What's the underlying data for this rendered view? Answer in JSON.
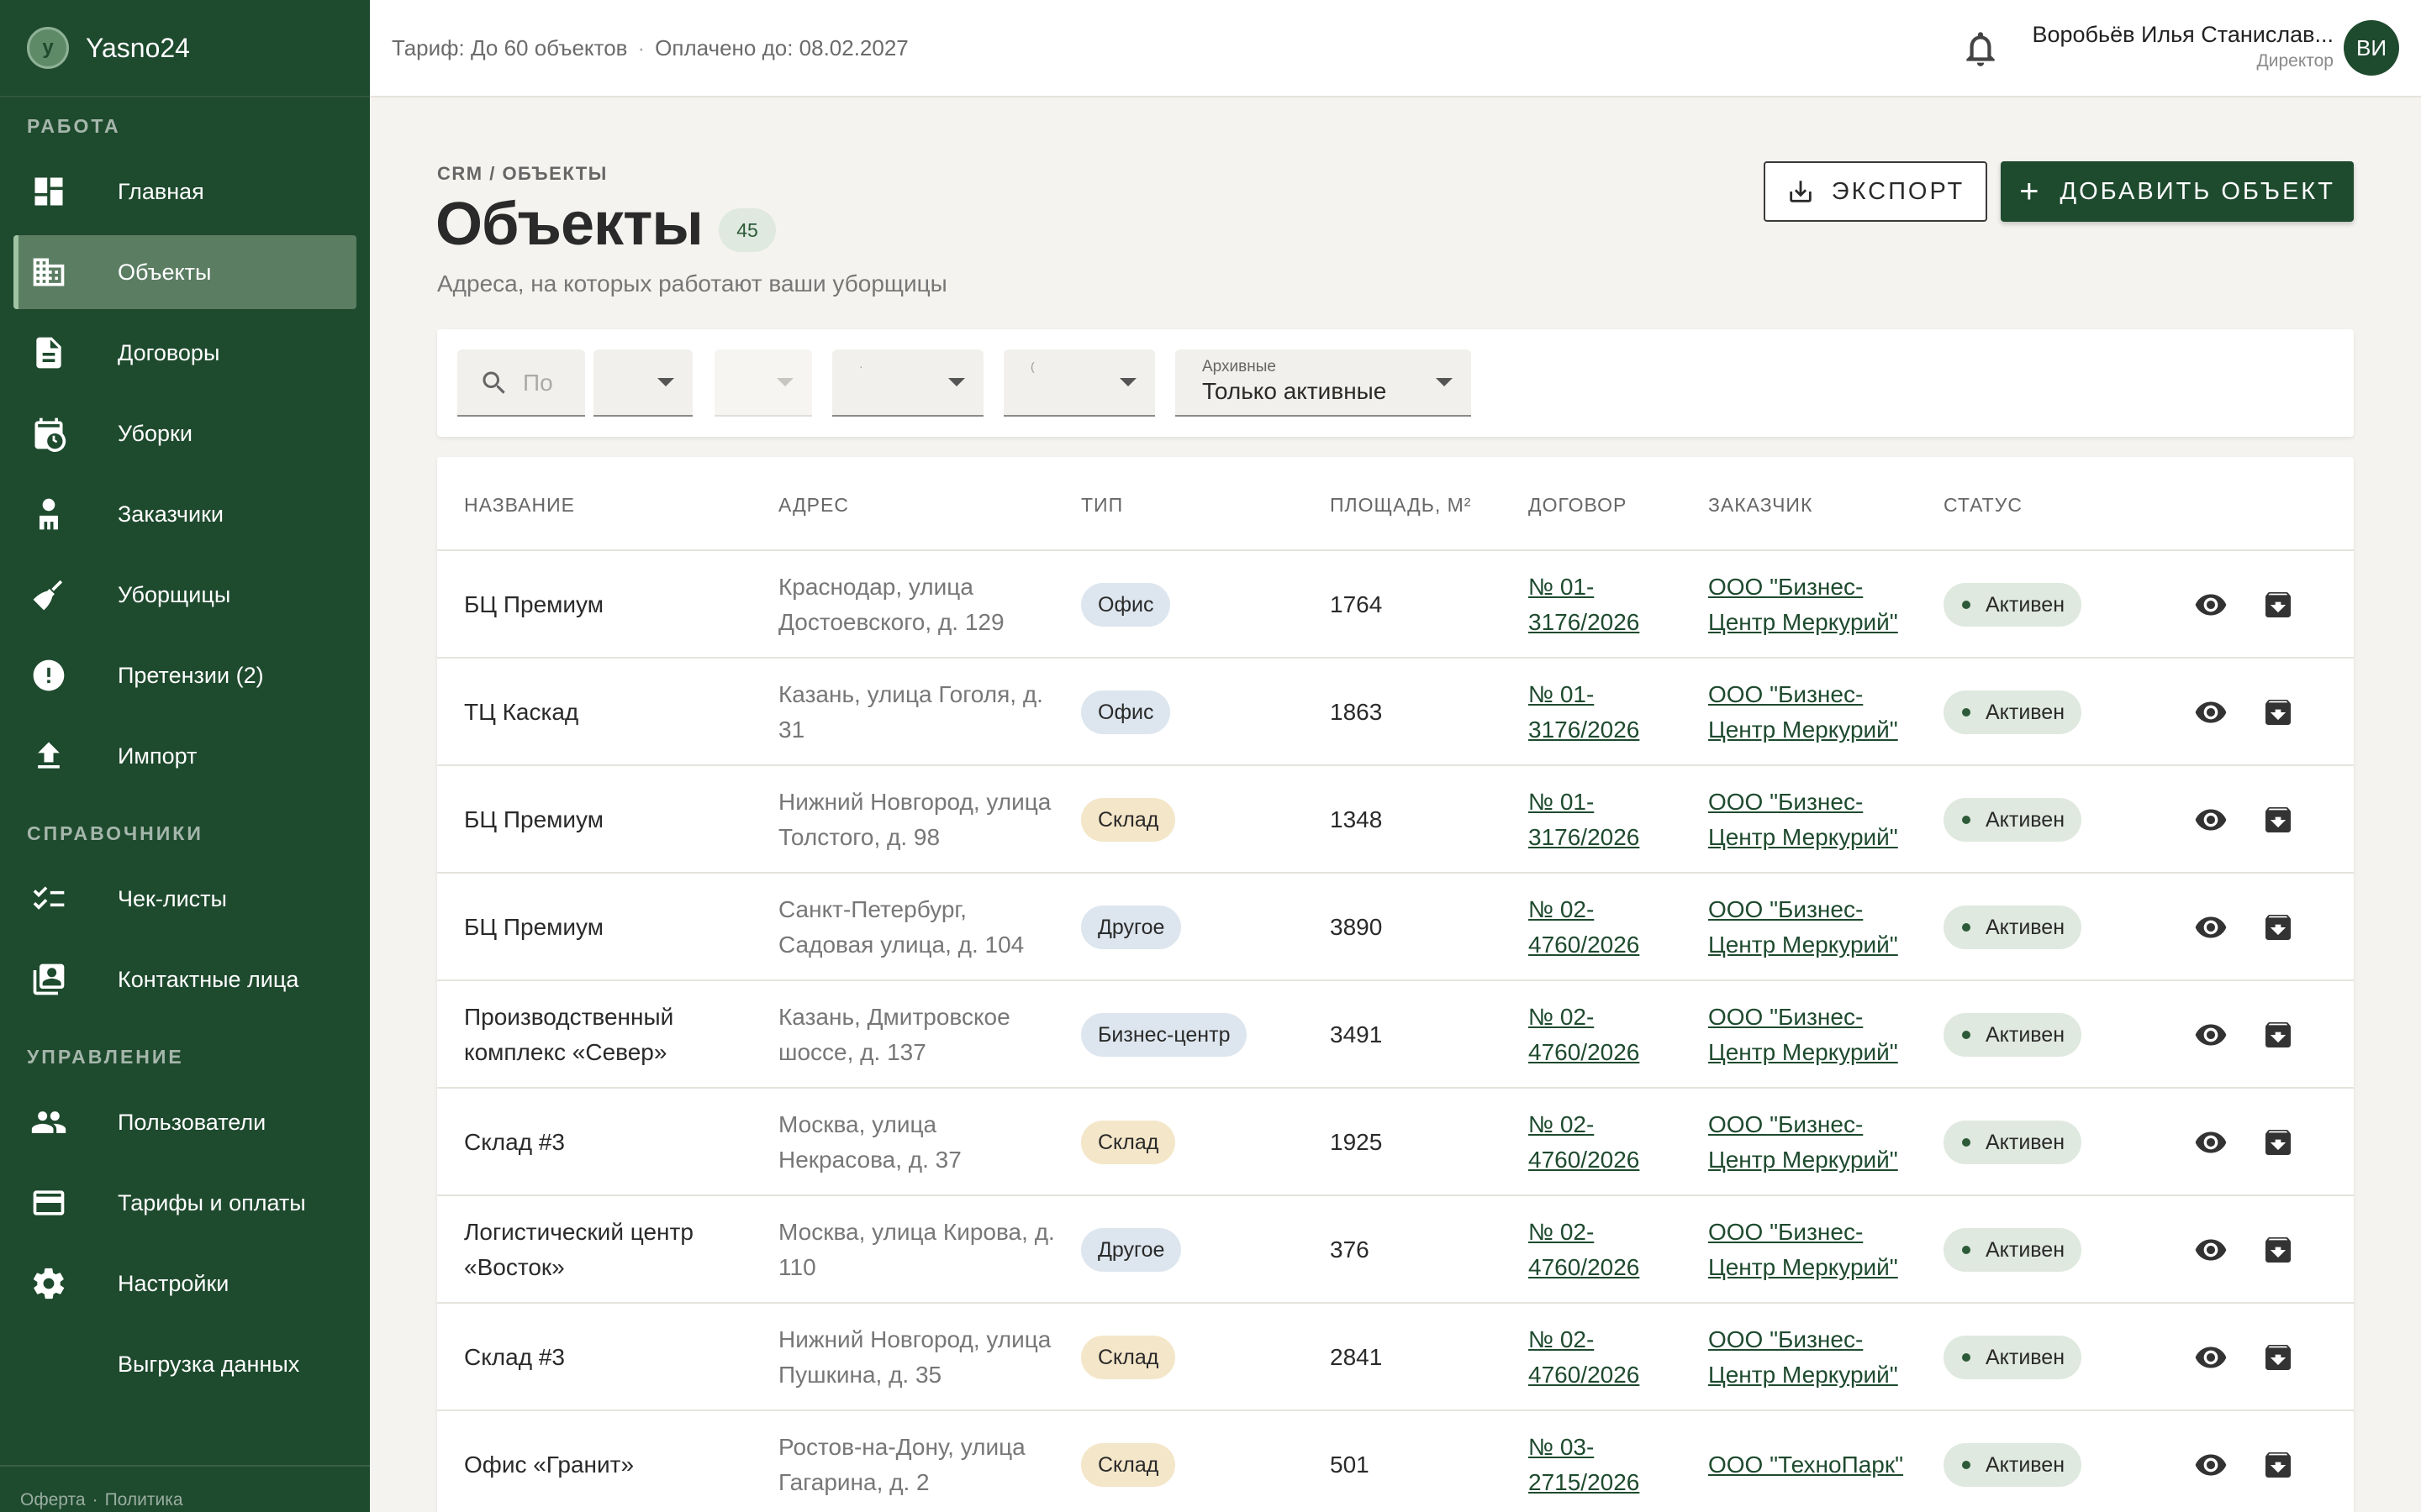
{
  "brand": {
    "logo_letter": "y",
    "name": "Yasno24"
  },
  "sidebar": {
    "sections": [
      {
        "title": "РАБОТА"
      },
      {
        "title": "СПРАВОЧНИКИ"
      },
      {
        "title": "УПРАВЛЕНИЕ"
      }
    ],
    "items": [
      {
        "label": "Главная",
        "icon": "dashboard-icon"
      },
      {
        "label": "Объекты",
        "icon": "building-icon",
        "active": true
      },
      {
        "label": "Договоры",
        "icon": "document-icon"
      },
      {
        "label": "Уборки",
        "icon": "calendar-clock-icon"
      },
      {
        "label": "Заказчики",
        "icon": "person-icon"
      },
      {
        "label": "Уборщицы",
        "icon": "broom-icon"
      },
      {
        "label": "Претензии (2)",
        "icon": "alert-icon"
      },
      {
        "label": "Импорт",
        "icon": "upload-icon"
      },
      {
        "label": "Чек-листы",
        "icon": "checklist-icon"
      },
      {
        "label": "Контактные лица",
        "icon": "contacts-icon"
      },
      {
        "label": "Пользователи",
        "icon": "users-icon"
      },
      {
        "label": "Тарифы и оплаты",
        "icon": "credit-card-icon"
      },
      {
        "label": "Настройки",
        "icon": "gear-icon"
      },
      {
        "label": "Выгрузка данных",
        "icon": ""
      }
    ],
    "footer": {
      "offer": "Оферта",
      "sep": "·",
      "policy": "Политика"
    }
  },
  "topbar": {
    "tariff": "Тариф: До 60 объектов",
    "dot": "·",
    "paid_until": "Оплачено до: 08.02.2027",
    "user_name": "Воробьёв Илья Станислав...",
    "user_role": "Директор",
    "avatar_initials": "ВИ"
  },
  "page": {
    "breadcrumb": "CRM / ОБЪЕКТЫ",
    "title": "Объекты",
    "count": "45",
    "subtitle": "Адреса, на которых работают ваши уборщицы",
    "export_label": "ЭКСПОРТ",
    "add_label": "ДОБАВИТЬ ОБЪЕКТ",
    "add_plus": "+"
  },
  "filters": {
    "search_placeholder": "По",
    "tiny_1": "·",
    "tiny_2": "(",
    "archive_label": "Архивные",
    "archive_value": "Только активные"
  },
  "table": {
    "headers": [
      "НАЗВАНИЕ",
      "АДРЕС",
      "ТИП",
      "ПЛОЩАДЬ, М²",
      "ДОГОВОР",
      "ЗАКАЗЧИК",
      "СТАТУС"
    ],
    "type_colors": {
      "Офис": "#dde6ee",
      "Склад": "#f4e6c8",
      "Другое": "#dde6ee",
      "Бизнес-центр": "#dde6ee"
    },
    "rows": [
      {
        "name": "БЦ Премиум",
        "address": "Краснодар, улица Достоевского, д. 129",
        "type": "Офис",
        "area": "1764",
        "contract": "№ 01-3176/2026",
        "customer": "ООО \"Бизнес-Центр Меркурий\"",
        "status": "Активен"
      },
      {
        "name": "ТЦ Каскад",
        "address": "Казань, улица Гоголя, д. 31",
        "type": "Офис",
        "area": "1863",
        "contract": "№ 01-3176/2026",
        "customer": "ООО \"Бизнес-Центр Меркурий\"",
        "status": "Активен"
      },
      {
        "name": "БЦ Премиум",
        "address": "Нижний Новгород, улица Толстого, д. 98",
        "type": "Склад",
        "area": "1348",
        "contract": "№ 01-3176/2026",
        "customer": "ООО \"Бизнес-Центр Меркурий\"",
        "status": "Активен"
      },
      {
        "name": "БЦ Премиум",
        "address": "Санкт-Петербург, Садовая улица, д. 104",
        "type": "Другое",
        "area": "3890",
        "contract": "№ 02-4760/2026",
        "customer": "ООО \"Бизнес-Центр Меркурий\"",
        "status": "Активен"
      },
      {
        "name": "Производственный комплекс «Север»",
        "address": "Казань, Дмитровское шоссе, д. 137",
        "type": "Бизнес-центр",
        "area": "3491",
        "contract": "№ 02-4760/2026",
        "customer": "ООО \"Бизнес-Центр Меркурий\"",
        "status": "Активен"
      },
      {
        "name": "Склад #3",
        "address": "Москва, улица Некрасова, д. 37",
        "type": "Склад",
        "area": "1925",
        "contract": "№ 02-4760/2026",
        "customer": "ООО \"Бизнес-Центр Меркурий\"",
        "status": "Активен"
      },
      {
        "name": "Логистический центр «Восток»",
        "address": "Москва, улица Кирова, д. 110",
        "type": "Другое",
        "area": "376",
        "contract": "№ 02-4760/2026",
        "customer": "ООО \"Бизнес-Центр Меркурий\"",
        "status": "Активен"
      },
      {
        "name": "Склад #3",
        "address": "Нижний Новгород, улица Пушкина, д. 35",
        "type": "Склад",
        "area": "2841",
        "contract": "№ 02-4760/2026",
        "customer": "ООО \"Бизнес-Центр Меркурий\"",
        "status": "Активен"
      },
      {
        "name": "Офис «Гранит»",
        "address": "Ростов-на-Дону, улица Гагарина, д. 2",
        "type": "Склад",
        "area": "501",
        "contract": "№ 03-2715/2026",
        "customer": "ООО \"ТехноПарк\"",
        "status": "Активен"
      }
    ]
  }
}
